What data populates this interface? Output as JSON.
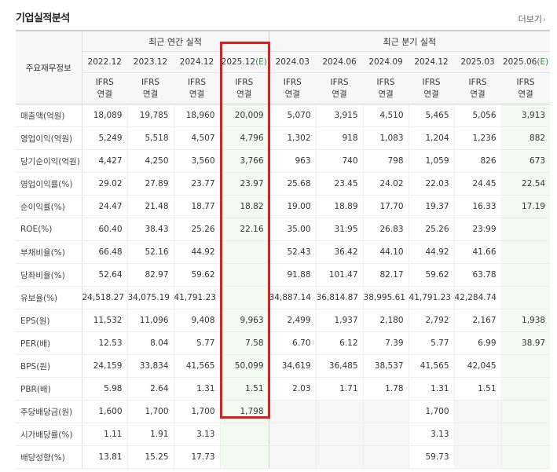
{
  "section_title": "기업실적분석",
  "more_link": "더보기",
  "header": {
    "row_label": "주요재무정보",
    "annual_group": "최근 연간 실적",
    "quarter_group": "최근 분기 실적",
    "annual_periods": [
      "2022.12",
      "2023.12",
      "2024.12",
      "2025.12"
    ],
    "quarter_periods": [
      "2024.03",
      "2024.06",
      "2024.09",
      "2024.12",
      "2025.03",
      "2025.06"
    ],
    "estimate_mark": "(E)",
    "accounting_top": "IFRS",
    "accounting_bottom": "연결"
  },
  "rows": [
    {
      "label": "매출액(억원)",
      "annual": [
        "18,089",
        "19,785",
        "18,960",
        "20,009"
      ],
      "quarter": [
        "5,070",
        "3,915",
        "4,510",
        "5,465",
        "5,056",
        "3,913"
      ]
    },
    {
      "label": "영업이익(억원)",
      "annual": [
        "5,249",
        "5,518",
        "4,507",
        "4,796"
      ],
      "quarter": [
        "1,302",
        "918",
        "1,083",
        "1,204",
        "1,236",
        "882"
      ]
    },
    {
      "label": "당기순이익(억원)",
      "annual": [
        "4,427",
        "4,250",
        "3,560",
        "3,766"
      ],
      "quarter": [
        "963",
        "740",
        "798",
        "1,059",
        "826",
        "673"
      ]
    },
    {
      "label": "영업이익률(%)",
      "annual": [
        "29.02",
        "27.89",
        "23.77",
        "23.97"
      ],
      "quarter": [
        "25.68",
        "23.45",
        "24.02",
        "22.03",
        "24.45",
        "22.54"
      ]
    },
    {
      "label": "순이익률(%)",
      "annual": [
        "24.47",
        "21.48",
        "18.77",
        "18.82"
      ],
      "quarter": [
        "19.00",
        "18.89",
        "17.70",
        "19.37",
        "16.33",
        "17.19"
      ]
    },
    {
      "label": "ROE(%)",
      "annual": [
        "60.40",
        "38.43",
        "25.26",
        "22.16"
      ],
      "quarter": [
        "35.00",
        "31.95",
        "26.83",
        "25.26",
        "23.99",
        ""
      ]
    },
    {
      "label": "부채비율(%)",
      "annual": [
        "66.48",
        "52.16",
        "44.92",
        ""
      ],
      "quarter": [
        "52.43",
        "36.42",
        "44.10",
        "44.92",
        "41.66",
        ""
      ]
    },
    {
      "label": "당좌비율(%)",
      "annual": [
        "52.64",
        "82.97",
        "59.62",
        ""
      ],
      "quarter": [
        "91.88",
        "101.47",
        "82.17",
        "59.62",
        "63.78",
        ""
      ]
    },
    {
      "label": "유보율(%)",
      "annual": [
        "24,518.27",
        "34,075.19",
        "41,791.23",
        ""
      ],
      "quarter": [
        "34,887.14",
        "36,814.87",
        "38,995.61",
        "41,791.23",
        "42,284.74",
        ""
      ]
    },
    {
      "label": "EPS(원)",
      "annual": [
        "11,532",
        "11,096",
        "9,408",
        "9,963"
      ],
      "quarter": [
        "2,499",
        "1,937",
        "2,180",
        "2,792",
        "2,167",
        "1,938"
      ]
    },
    {
      "label": "PER(배)",
      "annual": [
        "12.53",
        "8.04",
        "5.77",
        "7.58"
      ],
      "quarter": [
        "6.70",
        "6.12",
        "7.39",
        "5.77",
        "6.99",
        "38.97"
      ]
    },
    {
      "label": "BPS(원)",
      "annual": [
        "24,159",
        "33,834",
        "41,565",
        "50,099"
      ],
      "quarter": [
        "34,619",
        "36,485",
        "38,537",
        "41,565",
        "42,045",
        ""
      ]
    },
    {
      "label": "PBR(배)",
      "annual": [
        "5.98",
        "2.64",
        "1.31",
        "1.51"
      ],
      "quarter": [
        "2.03",
        "1.71",
        "1.78",
        "1.31",
        "1.51",
        ""
      ]
    },
    {
      "label": "주당배당금(원)",
      "annual": [
        "1,600",
        "1,700",
        "1,700",
        "1,798"
      ],
      "quarter": [
        "",
        "",
        "",
        "1,700",
        "",
        ""
      ]
    },
    {
      "label": "시가배당률(%)",
      "annual": [
        "1.11",
        "1.91",
        "3.13",
        ""
      ],
      "quarter": [
        "",
        "",
        "",
        "3.13",
        "",
        ""
      ]
    },
    {
      "label": "배당성향(%)",
      "annual": [
        "13.81",
        "15.25",
        "17.73",
        ""
      ],
      "quarter": [
        "",
        "",
        "",
        "59.73",
        "",
        ""
      ]
    }
  ]
}
